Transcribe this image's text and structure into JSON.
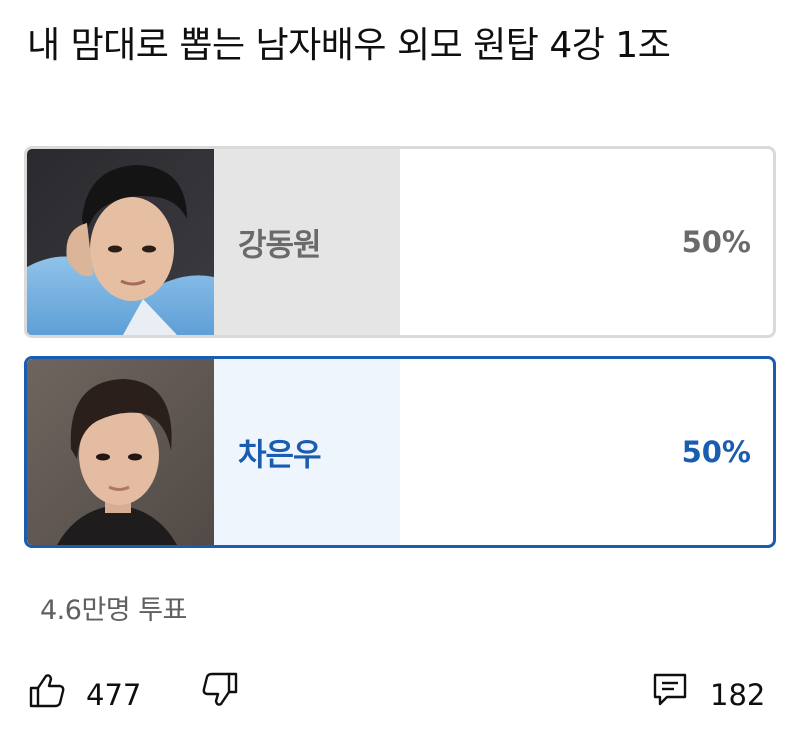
{
  "post": {
    "title": "내 맘대로 뽑는 남자배우 외모 원탑 4강 1조"
  },
  "poll": {
    "options": [
      {
        "name": "강동원",
        "percent": "50%",
        "fraction": 0.5,
        "selected": false
      },
      {
        "name": "차은우",
        "percent": "50%",
        "fraction": 0.5,
        "selected": true
      }
    ],
    "vote_count": "4.6만명 투표"
  },
  "actions": {
    "like_count": "477",
    "comment_count": "182"
  },
  "colors": {
    "selected_accent": "#1a5db0",
    "unselected_border": "#dadada",
    "unselected_fill": "#e5e5e5",
    "selected_fill": "#eef5fd"
  },
  "icons": {
    "like": "thumbs-up-icon",
    "dislike": "thumbs-down-icon",
    "comment": "comment-icon"
  }
}
